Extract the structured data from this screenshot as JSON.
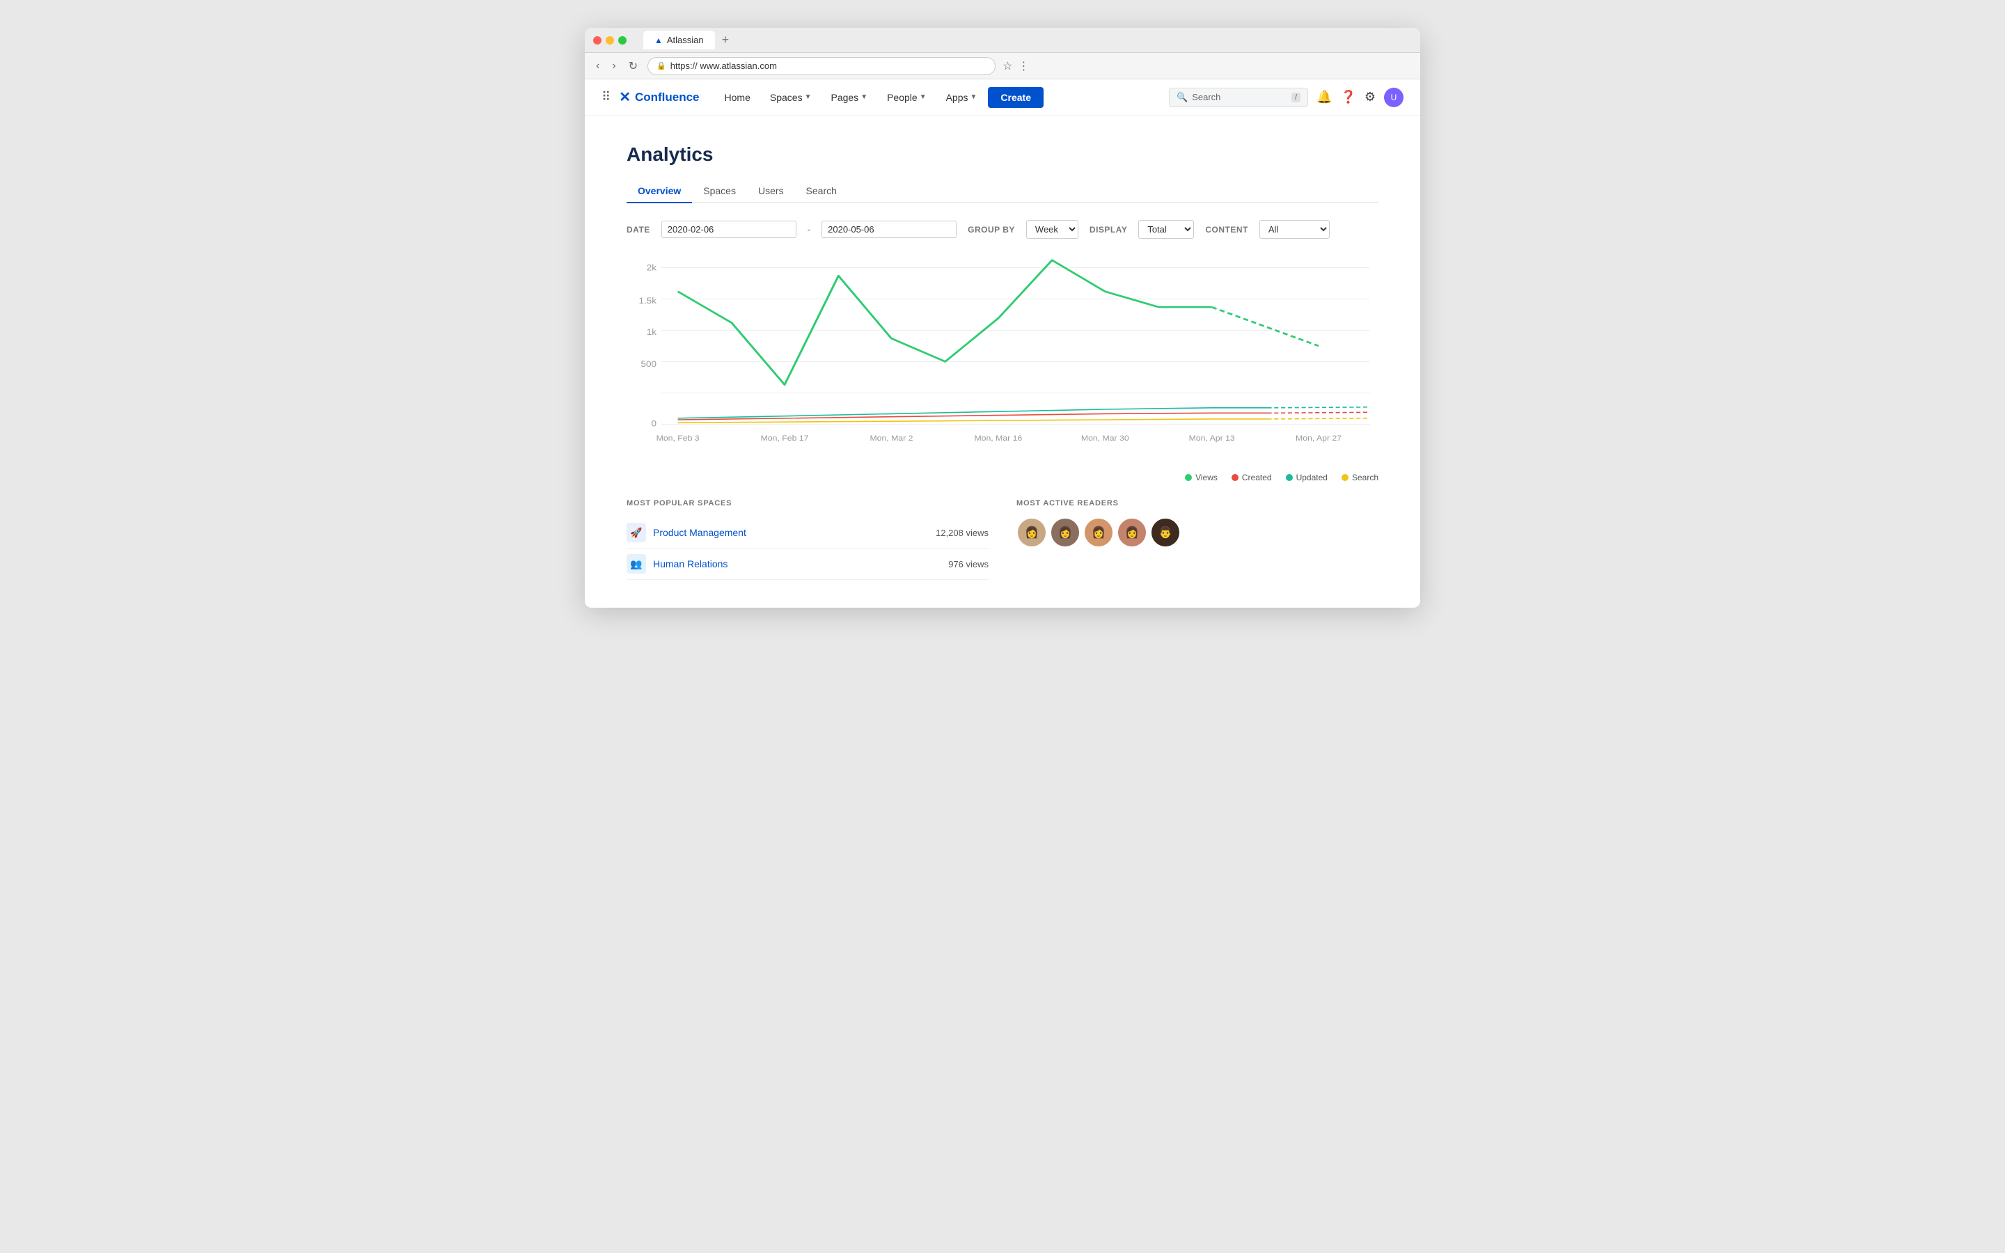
{
  "browser": {
    "tab_label": "Atlassian",
    "tab_plus": "+",
    "url": "https:// www.atlassian.com",
    "nav_back": "‹",
    "nav_forward": "›",
    "nav_refresh": "↻",
    "nav_bookmark": "☆",
    "nav_more": "⋮"
  },
  "confluence_nav": {
    "logo_text": "Confluence",
    "home": "Home",
    "spaces": "Spaces",
    "pages": "Pages",
    "people": "People",
    "apps": "Apps",
    "create": "Create",
    "search_placeholder": "Search",
    "search_shortcut": "/"
  },
  "analytics": {
    "page_title": "Analytics",
    "tabs": [
      {
        "id": "overview",
        "label": "Overview",
        "active": true
      },
      {
        "id": "spaces",
        "label": "Spaces",
        "active": false
      },
      {
        "id": "users",
        "label": "Users",
        "active": false
      },
      {
        "id": "search",
        "label": "Search",
        "active": false
      }
    ],
    "filters": {
      "date_label": "DATE",
      "date_from": "2020-02-06",
      "date_to": "2020-05-06",
      "date_separator": "-",
      "group_by_label": "GROUP BY",
      "group_by_value": "Week",
      "display_label": "DISPLAY",
      "display_value": "Total",
      "content_label": "CONTENT",
      "content_value": "All"
    },
    "chart": {
      "y_labels": [
        "2k",
        "1.5k",
        "1k",
        "500",
        "0"
      ],
      "x_labels": [
        "Mon, Feb 3",
        "Mon, Feb 17",
        "Mon, Mar 2",
        "Mon, Mar 16",
        "Mon, Mar 30",
        "Mon, Apr 13",
        "Mon, Apr 27"
      ]
    },
    "legend": [
      {
        "label": "Views",
        "color": "#2ecc71"
      },
      {
        "label": "Created",
        "color": "#e74c3c"
      },
      {
        "label": "Updated",
        "color": "#1abc9c"
      },
      {
        "label": "Search",
        "color": "#f1c40f"
      }
    ],
    "most_popular_spaces": {
      "section_title": "MOST POPULAR SPACES",
      "spaces": [
        {
          "name": "Product Management",
          "views": "12,208 views",
          "icon": "🚀",
          "bg": "#e8f0fe"
        },
        {
          "name": "Human Relations",
          "views": "976 views",
          "icon": "👥",
          "bg": "#e3f2fd"
        }
      ]
    },
    "most_active_readers": {
      "section_title": "MOST ACTIVE READERS"
    }
  }
}
